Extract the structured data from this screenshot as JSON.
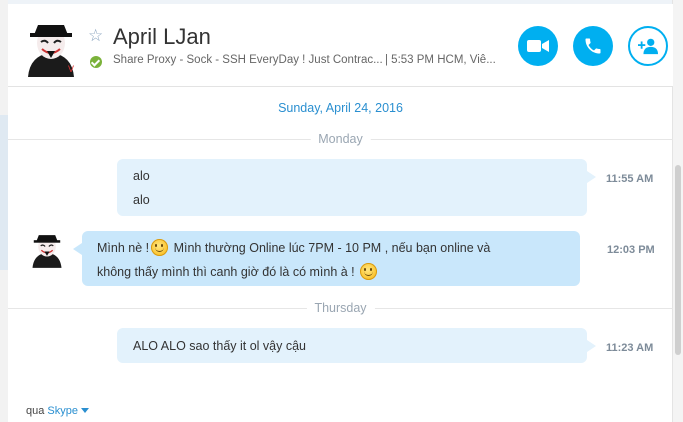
{
  "contact": {
    "name": "April LJan",
    "mood": "Share Proxy - Sock - SSH EveryDay ! Just Contrac...",
    "local_time": "| 5:53 PM HCM, Viê..."
  },
  "header_buttons": {
    "video_icon": "video-camera-icon",
    "call_icon": "phone-icon",
    "add_icon": "add-person-icon"
  },
  "conversation": {
    "date": "Sunday, April 24, 2016",
    "days": [
      "Monday",
      "Thursday"
    ],
    "messages": [
      {
        "lines": [
          "alo",
          "alo"
        ],
        "time": "11:55 AM",
        "direction": "outgoing"
      },
      {
        "lines": [
          "Mình nè !",
          " Mình thường Online lúc 7PM - 10 PM , nếu bạn online và",
          "không thấy mình thì canh giờ đó là có mình à !"
        ],
        "time": "12:03 PM",
        "direction": "incoming"
      },
      {
        "lines": [
          "ALO ALO sao thấy it ol vậy cậu"
        ],
        "time": "11:23 AM",
        "direction": "outgoing"
      }
    ]
  },
  "footer": {
    "prefix": "qua",
    "service": "Skype"
  },
  "colors": {
    "accent": "#00aff0",
    "link": "#2a8fd0",
    "bubble_out": "#e3f2fc",
    "bubble_in": "#c9e7fb",
    "online": "#7bb23a"
  }
}
